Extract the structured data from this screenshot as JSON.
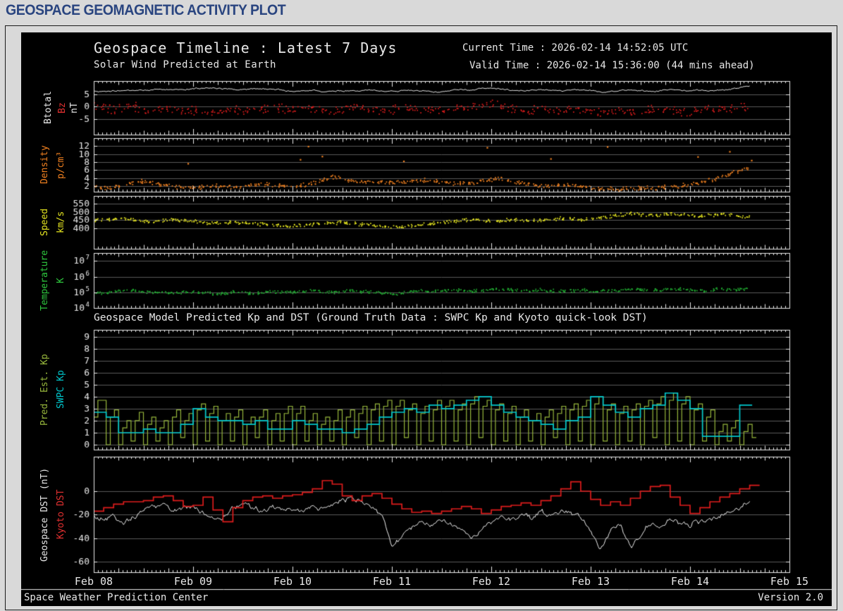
{
  "page": {
    "header": "GEOSPACE GEOMAGNETIC ACTIVITY PLOT"
  },
  "chart": {
    "title": "Geospace Timeline : Latest 7 Days",
    "subtitle": "Solar Wind Predicted at Earth",
    "current_time": "Current Time : 2026-02-14 14:52:05 UTC",
    "valid_time": "Valid Time : 2026-02-14 15:36:00 (44 mins ahead)",
    "mid_title": "Geospace Model Predicted Kp and DST (Ground Truth Data : SWPC Kp and Kyoto quick-look DST)",
    "footer_left": "Space Weather Prediction Center",
    "footer_right": "Version 2.0",
    "x_labels": [
      "Feb 08",
      "Feb 09",
      "Feb 10",
      "Feb 11",
      "Feb 12",
      "Feb 13",
      "Feb 14",
      "Feb 15"
    ],
    "colors": {
      "background": "#000000",
      "frame": "#e8e8e8",
      "grid": "#5a5a5a",
      "header_blue": "#2a4580",
      "white_series": "#f0f0f0",
      "red_series": "#dd1c1c",
      "orange_series": "#f08020",
      "yellow_series": "#e3e320",
      "green_series": "#21ad32",
      "pred_kp_green": "#97b73c",
      "swpc_kp_cyan": "#00c6cc"
    }
  },
  "chart_data": {
    "type": "multi-panel-timeseries",
    "x_unit": "days since Feb 08 00:00 UT",
    "x_range": [
      0,
      7
    ],
    "panels": [
      {
        "id": "bfield",
        "ylabels": [
          {
            "text": "Btotal",
            "color": "#e8e8e8"
          },
          {
            "text": "Bz",
            "color": "#e03030"
          },
          {
            "text": "nT",
            "color": "#e8e8e8"
          }
        ],
        "ylim": [
          -11.3,
          10.3
        ],
        "yticks": [
          5,
          0,
          -5
        ],
        "series": [
          {
            "name": "Btotal",
            "color": "#f0f0f0",
            "style": "noisy-line",
            "x0": 0,
            "dx": 0.1,
            "noise": 0.3,
            "y": [
              6.2,
              6.0,
              6.3,
              6.5,
              6.4,
              6.6,
              6.8,
              7.0,
              6.9,
              7.0,
              7.1,
              7.3,
              7.4,
              7.2,
              7.0,
              6.9,
              7.0,
              7.2,
              7.0,
              6.6,
              5.9,
              6.2,
              6.6,
              6.1,
              6.3,
              6.5,
              6.4,
              6.6,
              6.8,
              6.4,
              6.1,
              6.3,
              6.6,
              6.4,
              6.1,
              5.9,
              6.4,
              6.9,
              6.6,
              7.3,
              7.5,
              7.2,
              6.8,
              6.4,
              6.6,
              6.9,
              6.6,
              6.3,
              6.6,
              6.9,
              6.6,
              5.8,
              6.1,
              6.4,
              6.7,
              6.4,
              6.2,
              6.5,
              6.9,
              6.6,
              6.3,
              6.6,
              6.4,
              6.7,
              7.0,
              7.5,
              8.2
            ]
          },
          {
            "name": "Bz",
            "color": "#dd1c1c",
            "style": "scatter",
            "x0": 0,
            "dx": 0.1,
            "spread": 2.2,
            "dots": 7,
            "y": [
              0.3,
              -0.6,
              -1.2,
              -0.4,
              0.2,
              -1.4,
              -2.0,
              -1.0,
              -0.4,
              -1.0,
              -1.6,
              -2.2,
              -2.4,
              -1.8,
              -1.4,
              -1.0,
              -1.5,
              -1.0,
              -0.5,
              -1.0,
              -1.5,
              -1.0,
              -0.5,
              -1.5,
              -2.0,
              -1.0,
              -0.5,
              0.0,
              -1.0,
              -1.6,
              -1.0,
              -0.4,
              -1.0,
              -1.6,
              -1.0,
              -2.0,
              -1.5,
              -1.0,
              -0.5,
              0.5,
              1.0,
              0.0,
              -1.0,
              -2.0,
              -1.5,
              -1.0,
              -1.5,
              -2.0,
              -1.0,
              -0.5,
              -2.0,
              -2.5,
              -2.0,
              -1.4,
              -2.4,
              -2.0,
              -1.5,
              -1.0,
              -2.0,
              -2.4,
              -2.0,
              -1.5,
              -1.0,
              -1.5,
              -1.0,
              -0.4,
              0.4
            ]
          }
        ]
      },
      {
        "id": "density",
        "ylabels": [
          {
            "text": "Density",
            "color": "#f08020"
          },
          {
            "text": "p/cm³",
            "color": "#f08020"
          }
        ],
        "ylim": [
          0.6,
          14.0
        ],
        "yticks": [
          12,
          10,
          8,
          6,
          4,
          2
        ],
        "series": [
          {
            "name": "Density",
            "color": "#f08020",
            "style": "scatter",
            "x0": 0,
            "dx": 0.1,
            "spread": 0.6,
            "dots": 8,
            "y": [
              1.6,
              1.5,
              1.8,
              2.2,
              2.8,
              3.2,
              2.8,
              2.2,
              1.9,
              1.7,
              1.6,
              1.8,
              2.0,
              2.0,
              1.9,
              2.0,
              2.2,
              2.4,
              2.2,
              2.1,
              2.0,
              2.2,
              2.6,
              3.4,
              4.2,
              3.8,
              3.2,
              3.0,
              3.1,
              3.0,
              2.9,
              3.0,
              3.2,
              3.5,
              3.3,
              3.0,
              2.8,
              2.6,
              2.8,
              3.1,
              3.6,
              4.0,
              3.4,
              2.6,
              2.2,
              2.0,
              2.2,
              2.3,
              2.1,
              1.9,
              1.6,
              1.4,
              1.3,
              1.3,
              1.4,
              1.5,
              1.5,
              1.6,
              1.8,
              2.0,
              2.4,
              2.9,
              3.5,
              4.2,
              5.0,
              5.8,
              6.4
            ]
          },
          {
            "name": "Density high outliers",
            "color": "#f08020",
            "style": "points",
            "points": [
              [
                0.95,
                7.6
              ],
              [
                2.08,
                8.6
              ],
              [
                2.16,
                11.9
              ],
              [
                2.3,
                9.4
              ],
              [
                3.12,
                8.2
              ],
              [
                3.96,
                11.6
              ],
              [
                4.6,
                8.8
              ],
              [
                5.17,
                11.8
              ],
              [
                6.08,
                9.3
              ],
              [
                6.4,
                10.6
              ],
              [
                6.62,
                8.4
              ]
            ]
          }
        ]
      },
      {
        "id": "speed",
        "ylabels": [
          {
            "text": "Speed",
            "color": "#e3e320"
          },
          {
            "text": "km/s",
            "color": "#e3e320"
          }
        ],
        "ylim": [
          275,
          597
        ],
        "yticks": [
          550,
          500,
          450,
          400
        ],
        "series": [
          {
            "name": "Speed",
            "color": "#e3e320",
            "style": "scatter",
            "x0": 0,
            "dx": 0.1,
            "spread": 13,
            "dots": 8,
            "y": [
              452,
              448,
              455,
              460,
              452,
              445,
              440,
              448,
              452,
              446,
              440,
              434,
              430,
              434,
              438,
              432,
              428,
              424,
              420,
              416,
              414,
              418,
              424,
              428,
              432,
              436,
              430,
              424,
              418,
              412,
              406,
              410,
              416,
              422,
              428,
              434,
              440,
              446,
              450,
              446,
              442,
              446,
              452,
              448,
              444,
              448,
              454,
              460,
              456,
              450,
              458,
              466,
              474,
              482,
              488,
              484,
              478,
              482,
              488,
              484,
              478,
              472,
              478,
              486,
              480,
              472,
              466
            ]
          }
        ]
      },
      {
        "id": "temp",
        "log": true,
        "ylabels": [
          {
            "text": "Temperature",
            "color": "#2ec73e"
          },
          {
            "text": "K",
            "color": "#2ec73e"
          }
        ],
        "ylim": [
          3.99,
          7.52
        ],
        "yticks": [
          7,
          6,
          5,
          4
        ],
        "series": [
          {
            "name": "Temperature",
            "color": "#21ad32",
            "style": "scatter",
            "x0": 0,
            "dx": 0.1,
            "spread": 0.12,
            "dots": 8,
            "y": [
              4.95,
              4.9,
              5.05,
              5.15,
              5.1,
              5.05,
              5.0,
              5.0,
              4.95,
              5.0,
              5.0,
              4.95,
              4.9,
              4.95,
              5.0,
              5.0,
              4.95,
              5.0,
              5.05,
              5.0,
              5.0,
              5.05,
              5.1,
              5.05,
              5.0,
              5.05,
              5.1,
              5.05,
              5.0,
              4.95,
              4.9,
              4.95,
              5.05,
              5.1,
              5.05,
              5.1,
              5.15,
              5.1,
              5.05,
              5.1,
              5.15,
              5.2,
              5.15,
              5.1,
              5.1,
              5.15,
              5.1,
              5.05,
              5.1,
              5.15,
              5.1,
              5.05,
              5.1,
              5.15,
              5.2,
              5.15,
              5.1,
              5.15,
              5.25,
              5.2,
              5.15,
              5.1,
              5.15,
              5.2,
              5.15,
              5.2,
              5.25
            ]
          }
        ]
      },
      {
        "id": "kp",
        "ylabels": [
          {
            "text": "Pred. Est. Kp",
            "color": "#97b73c"
          },
          {
            "text": "SWPC Kp",
            "color": "#00c6cc"
          }
        ],
        "ylim": [
          -0.41,
          9.57
        ],
        "yticks": [
          9,
          8,
          7,
          6,
          5,
          4,
          3,
          2,
          1,
          0
        ],
        "series": [
          {
            "name": "Pred. Est. Kp",
            "color": "#97b73c",
            "style": "step",
            "lw": 1.2,
            "x0": 0,
            "dx": 0.0416667,
            "y": [
              2.3,
              3.7,
              3.7,
              0,
              2.3,
              2.9,
              0,
              1.4,
              2.0,
              0.3,
              2.0,
              2.7,
              0,
              1.7,
              2.3,
              0.3,
              1.4,
              2.0,
              0,
              2.3,
              2.9,
              0.6,
              2.0,
              2.6,
              0,
              2.9,
              3.4,
              0.3,
              2.6,
              3.2,
              0,
              2.0,
              2.6,
              0.3,
              2.3,
              2.9,
              0,
              1.7,
              2.3,
              0.6,
              2.3,
              2.9,
              0,
              2.0,
              2.6,
              0.3,
              2.6,
              3.2,
              0,
              2.6,
              3.2,
              0.3,
              2.0,
              2.6,
              0,
              1.7,
              2.3,
              0.3,
              2.0,
              2.9,
              0,
              2.3,
              2.9,
              0.6,
              2.6,
              3.2,
              0,
              2.9,
              3.4,
              0.3,
              3.2,
              3.7,
              0,
              3.2,
              3.7,
              0.6,
              2.9,
              3.4,
              0,
              2.6,
              3.2,
              0.3,
              2.9,
              3.7,
              0,
              3.2,
              3.7,
              0.3,
              2.9,
              3.4,
              0,
              3.4,
              4.0,
              0.6,
              3.2,
              3.7,
              0,
              2.9,
              3.4,
              0.3,
              2.6,
              3.2,
              0,
              2.3,
              2.9,
              0.3,
              2.0,
              2.6,
              0,
              2.3,
              2.9,
              0.6,
              2.6,
              3.2,
              0,
              2.9,
              3.4,
              0.3,
              3.2,
              3.7,
              0,
              3.4,
              4.0,
              0.3,
              2.9,
              3.4,
              0,
              2.6,
              3.2,
              0.3,
              2.9,
              3.4,
              0,
              3.2,
              3.7,
              0.6,
              3.4,
              4.0,
              0,
              3.7,
              4.3,
              0.3,
              3.4,
              4.0,
              0,
              2.9,
              3.4,
              0.3,
              2.3,
              2.9,
              0,
              1.1,
              1.7,
              0.3,
              1.4,
              2.0,
              0,
              1.1,
              1.7,
              0.6
            ]
          },
          {
            "name": "SWPC Kp",
            "color": "#00c6cc",
            "style": "step",
            "lw": 1.7,
            "x0": 0,
            "dx": 0.125,
            "y": [
              2.7,
              2.3,
              1.0,
              1.0,
              1.3,
              1.0,
              1.0,
              1.7,
              3.0,
              2.3,
              2.0,
              2.0,
              1.7,
              2.0,
              1.3,
              1.3,
              2.0,
              1.7,
              1.3,
              1.3,
              1.0,
              1.3,
              1.7,
              2.3,
              2.7,
              3.0,
              2.7,
              3.3,
              3.0,
              3.3,
              3.7,
              4.0,
              3.3,
              2.7,
              2.3,
              2.0,
              1.7,
              1.3,
              2.0,
              2.3,
              4.0,
              3.3,
              2.7,
              2.3,
              3.0,
              3.3,
              4.3,
              3.7,
              3.0,
              0.7,
              0.7,
              0.7,
              3.3
            ]
          }
        ]
      },
      {
        "id": "dst",
        "ylabels": [
          {
            "text": "Geospace DST (nT)",
            "color": "#e8e8e8"
          },
          {
            "text": "Kyoto DST",
            "color": "#e03030"
          }
        ],
        "ylim": [
          -69,
          29.4
        ],
        "yticks": [
          0,
          -20,
          -40,
          -60
        ],
        "series": [
          {
            "name": "Geospace DST",
            "color": "#f0f0f0",
            "style": "noisy-line",
            "lw": 1,
            "x0": 0,
            "dx": 0.1,
            "noise": 2.4,
            "y": [
              -22,
              -24,
              -21,
              -27,
              -22,
              -16,
              -13,
              -11,
              -17,
              -12,
              -14,
              -18,
              -25,
              -23,
              -15,
              -10,
              -14,
              -17,
              -14,
              -16,
              -14,
              -16,
              -13,
              -15,
              -11,
              -9,
              -6,
              -10,
              -14,
              -20,
              -47,
              -38,
              -30,
              -27,
              -30,
              -26,
              -29,
              -33,
              -40,
              -33,
              -26,
              -21,
              -24,
              -19,
              -23,
              -17,
              -21,
              -15,
              -18,
              -22,
              -32,
              -50,
              -34,
              -28,
              -48,
              -38,
              -27,
              -32,
              -22,
              -28,
              -28,
              -26,
              -23,
              -21,
              -18,
              -13,
              -8
            ]
          },
          {
            "name": "Kyoto DST",
            "color": "#dd1c1c",
            "style": "step",
            "lw": 1.7,
            "x0": 0,
            "dx": 0.1,
            "y": [
              -17,
              -14,
              -11,
              -9,
              -9,
              -8,
              -5,
              -4,
              -8,
              -13,
              -12,
              -5,
              -16,
              -26,
              -14,
              -8,
              -5,
              -4,
              -6,
              -4,
              -3,
              -1,
              2,
              9,
              6,
              -4,
              -8,
              -4,
              -2,
              -6,
              -11,
              -15,
              -18,
              -17,
              -19,
              -17,
              -15,
              -13,
              -15,
              -19,
              -16,
              -13,
              -12,
              -10,
              -12,
              -8,
              -4,
              2,
              8,
              0,
              -7,
              -12,
              -9,
              -12,
              -6,
              0,
              4,
              5,
              -5,
              -12,
              -19,
              -14,
              -9,
              -5,
              -2,
              2,
              5
            ]
          }
        ]
      }
    ]
  }
}
